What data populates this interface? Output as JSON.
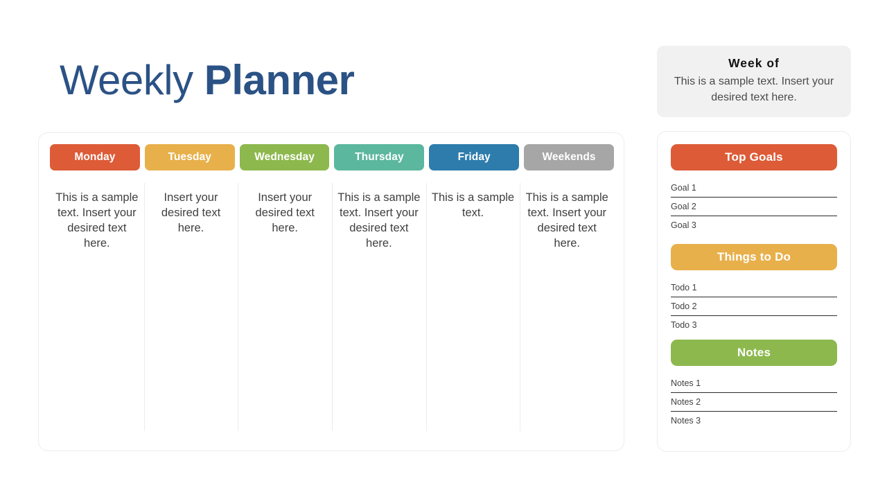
{
  "title": {
    "regular": "Weekly ",
    "bold": "Planner"
  },
  "week_card": {
    "days": [
      {
        "label": "Monday",
        "color": "#dd5b37",
        "text": "This is a sample text. Insert your desired text here."
      },
      {
        "label": "Tuesday",
        "color": "#e8b04b",
        "text": "Insert your desired text here."
      },
      {
        "label": "Wednesday",
        "color": "#8db84e",
        "text": "Insert your desired text here."
      },
      {
        "label": "Thursday",
        "color": "#5bb79e",
        "text": "This is a sample text. Insert your desired text here."
      },
      {
        "label": "Friday",
        "color": "#2d7cac",
        "text": "This is a sample text."
      },
      {
        "label": "Weekends",
        "color": "#a6a6a6",
        "text": "This is a sample text. Insert your desired text here."
      }
    ]
  },
  "week_of": {
    "title": "Week of",
    "text": "This is a sample text. Insert your desired text here."
  },
  "sidebar": {
    "sections": [
      {
        "title": "Top Goals",
        "color": "#dd5b37",
        "items": [
          "Goal 1",
          "Goal 2",
          "Goal 3"
        ]
      },
      {
        "title": "Things to Do",
        "color": "#e8b04b",
        "items": [
          "Todo 1",
          "Todo 2",
          "Todo 3"
        ]
      },
      {
        "title": "Notes",
        "color": "#8db84e",
        "items": [
          "Notes 1",
          "Notes 2",
          "Notes 3"
        ]
      }
    ]
  }
}
